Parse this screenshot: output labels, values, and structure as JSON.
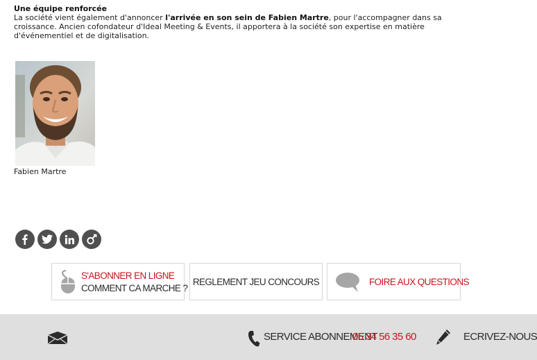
{
  "article": {
    "heading": "Une équipe renforcée",
    "para1_before": "La société vient également d'annoncer ",
    "para1_bold": "l'arrivée en son sein de Fabien Martre",
    "para1_after": ", pour l'accompagner dans sa croissance. Ancien cofondateur d'Ideal Meeting & Events, il apportera à la société son expertise en matière d'événementiel et de digitalisation.",
    "photo_caption": "Fabien Martre"
  },
  "social": [
    {
      "icon": "facebook-icon"
    },
    {
      "icon": "twitter-icon"
    },
    {
      "icon": "linkedin-icon"
    },
    {
      "icon": "viadeo-icon"
    }
  ],
  "cards": {
    "subscribe_line1": "S'ABONNER EN LIGNE",
    "subscribe_line2": "COMMENT CA MARCHE ?",
    "contest": "REGLEMENT JEU CONCOURS",
    "faq": "FOIRE AUX QUESTIONS"
  },
  "footer": {
    "service_label": "SERVICE ABONNEMENT",
    "service_phone": "05 34 56 35 60",
    "write_label": "ECRIVEZ-NOUS"
  },
  "colors": {
    "accent_red": "#c7141b",
    "footer_bg": "#dfdfdf",
    "icon_dark": "#4f4f4f"
  }
}
